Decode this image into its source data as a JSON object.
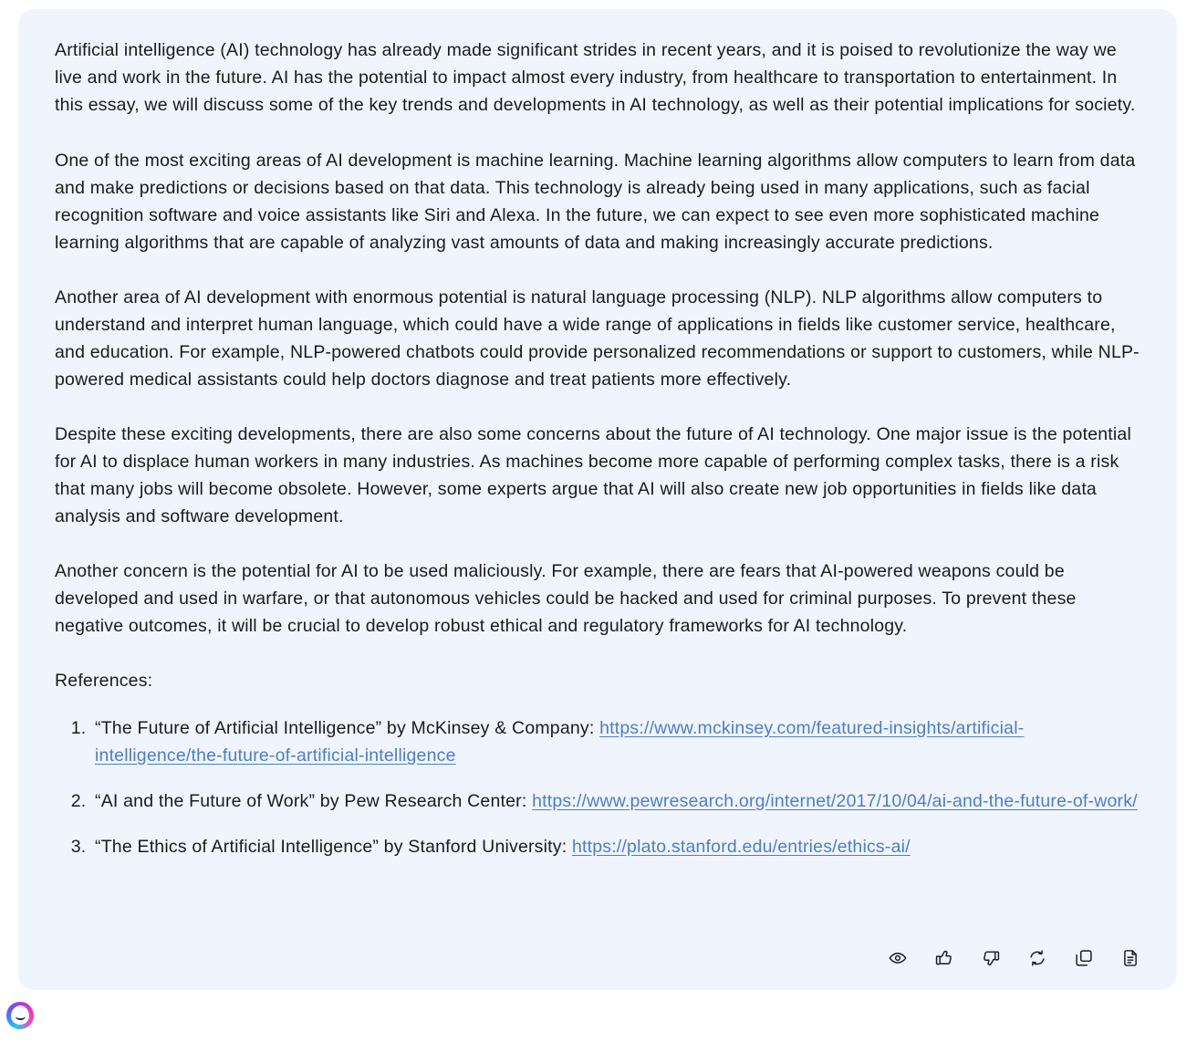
{
  "message": {
    "paragraphs": [
      "Artificial intelligence (AI) technology has already made significant strides in recent years, and it is poised to revolutionize the way we live and work in the future. AI has the potential to impact almost every industry, from healthcare to transportation to entertainment. In this essay, we will discuss some of the key trends and developments in AI technology, as well as their potential implications for society.",
      "One of the most exciting areas of AI development is machine learning. Machine learning algorithms allow computers to learn from data and make predictions or decisions based on that data. This technology is already being used in many applications, such as facial recognition software and voice assistants like Siri and Alexa. In the future, we can expect to see even more sophisticated machine learning algorithms that are capable of analyzing vast amounts of data and making increasingly accurate predictions.",
      "Another area of AI development with enormous potential is natural language processing (NLP). NLP algorithms allow computers to understand and interpret human language, which could have a wide range of applications in fields like customer service, healthcare, and education. For example, NLP-powered chatbots could provide personalized recommendations or support to customers, while NLP-powered medical assistants could help doctors diagnose and treat patients more effectively.",
      "Despite these exciting developments, there are also some concerns about the future of AI technology. One major issue is the potential for AI to displace human workers in many industries. As machines become more capable of performing complex tasks, there is a risk that many jobs will become obsolete. However, some experts argue that AI will also create new job opportunities in fields like data analysis and software development.",
      "Another concern is the potential for AI to be used maliciously. For example, there are fears that AI-powered weapons could be developed and used in warfare, or that autonomous vehicles could be hacked and used for criminal purposes. To prevent these negative outcomes, it will be crucial to develop robust ethical and regulatory frameworks for AI technology."
    ],
    "references_label": "References:",
    "references": [
      {
        "prefix": "“The Future of Artificial Intelligence” by McKinsey & Company: ",
        "link_text": "https://www.mckinsey.com/featured-insights/artificial-intelligence/the-future-of-artificial-intelligence"
      },
      {
        "prefix": "“AI and the Future of Work” by Pew Research Center: ",
        "link_text": "https://www.pewresearch.org/internet/2017/10/04/ai-and-the-future-of-work/"
      },
      {
        "prefix": "“The Ethics of Artificial Intelligence” by Stanford University: ",
        "link_text": "https://plato.stanford.edu/entries/ethics-ai/"
      }
    ]
  },
  "actions": [
    {
      "name": "read-aloud",
      "icon": "eye-icon"
    },
    {
      "name": "like",
      "icon": "thumbs-up-icon"
    },
    {
      "name": "dislike",
      "icon": "thumbs-down-icon"
    },
    {
      "name": "regenerate",
      "icon": "refresh-icon"
    },
    {
      "name": "copy",
      "icon": "copy-icon"
    },
    {
      "name": "export",
      "icon": "document-icon"
    }
  ],
  "avatar": {
    "name": "assistant-avatar"
  },
  "colors": {
    "card_background": "#eff4fd",
    "page_background": "#ffffff",
    "text": "#1b1b1b",
    "link": "#4e7fc1",
    "icon": "#1a1a1f"
  }
}
